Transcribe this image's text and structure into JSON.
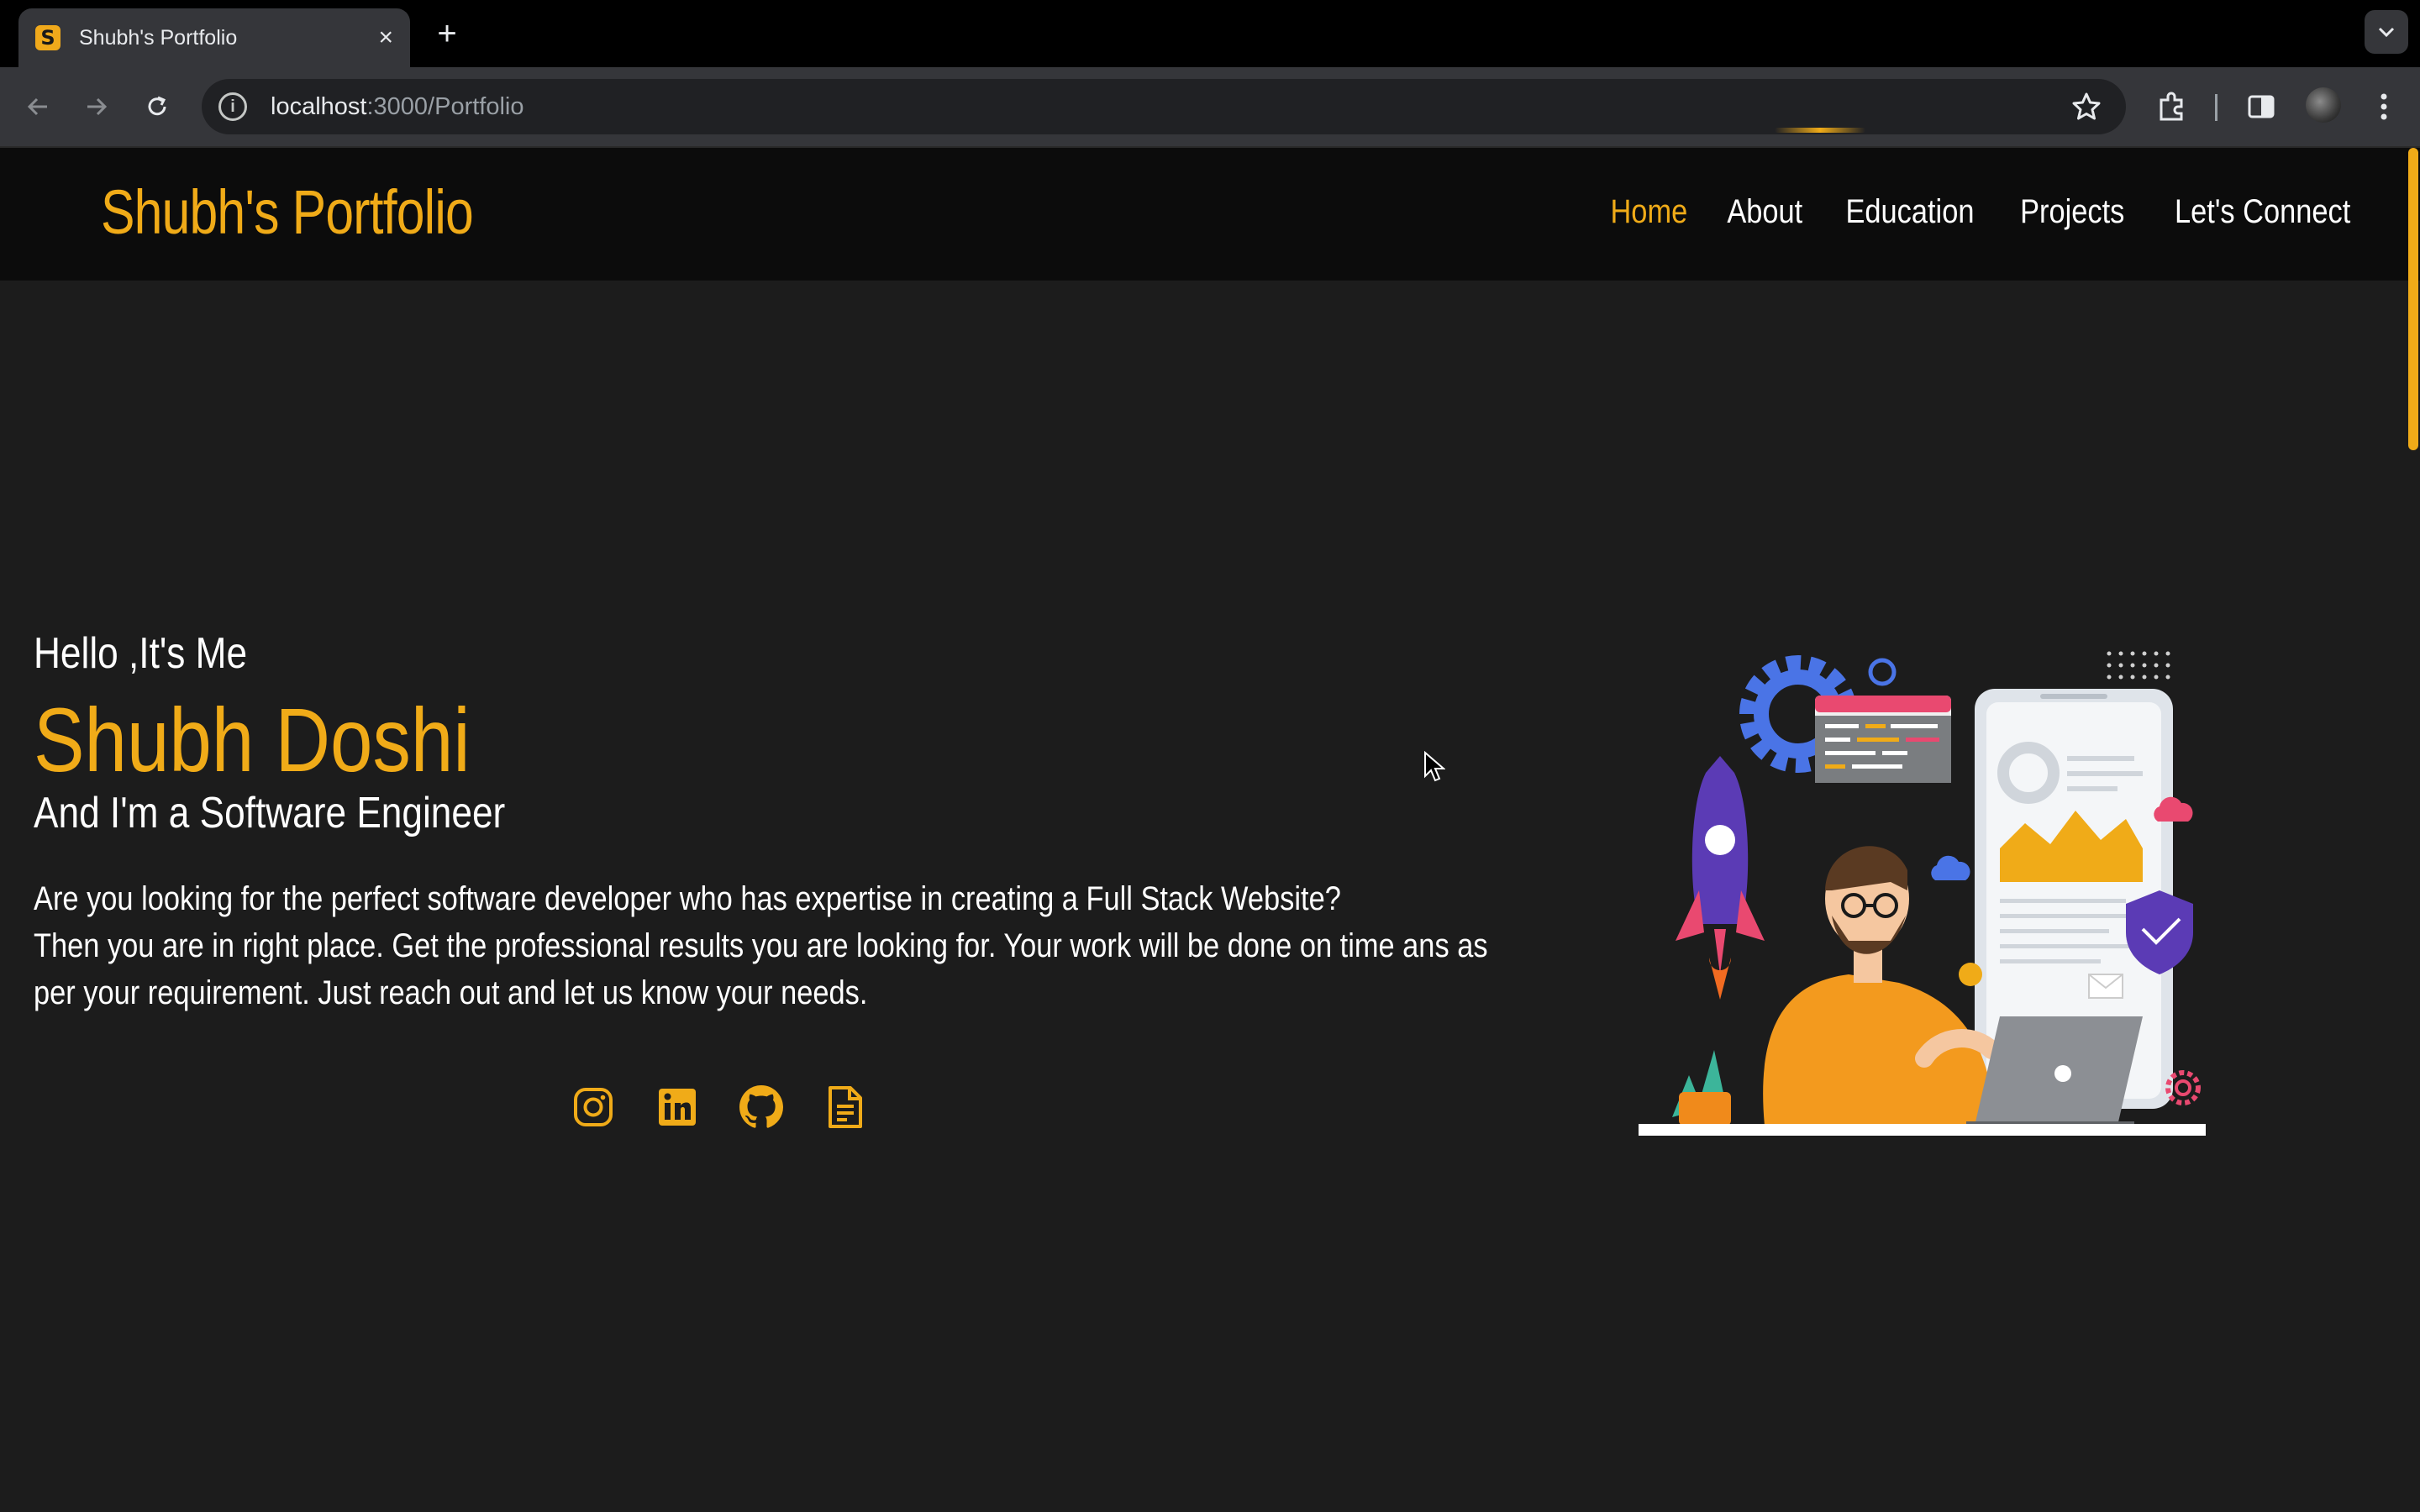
{
  "browser": {
    "tab": {
      "title": "Shubh's Portfolio",
      "favicon_letter": "S"
    },
    "url": {
      "host": "localhost",
      "path": ":3000/Portfolio"
    },
    "icons": [
      "back-icon",
      "forward-icon",
      "reload-icon",
      "info-icon",
      "star-icon",
      "extensions-icon",
      "side-panel-icon",
      "menu-icon"
    ]
  },
  "site": {
    "brand": "Shubh's Portfolio",
    "nav": [
      {
        "label": "Home",
        "active": true
      },
      {
        "label": "About",
        "active": false
      },
      {
        "label": "Education",
        "active": false
      },
      {
        "label": "Projects",
        "active": false
      },
      {
        "label": "Let's Connect",
        "active": false
      }
    ],
    "accent_color": "#f0ab18"
  },
  "hero": {
    "greeting": "Hello ,It's Me",
    "name": "Shubh Doshi",
    "role_prefix": "And I'm a ",
    "role": "Software Engineer",
    "description_line1": "Are you looking for the perfect software developer who has expertise in creating a Full Stack Website?",
    "description_line2": "Then you are in right place. Get the professional results you are looking for. Your work will be done on time ans as",
    "description_line3": "per your requirement. Just reach out and let us know your needs.",
    "socials": [
      "instagram-icon",
      "linkedin-icon",
      "github-icon",
      "resume-icon"
    ]
  }
}
